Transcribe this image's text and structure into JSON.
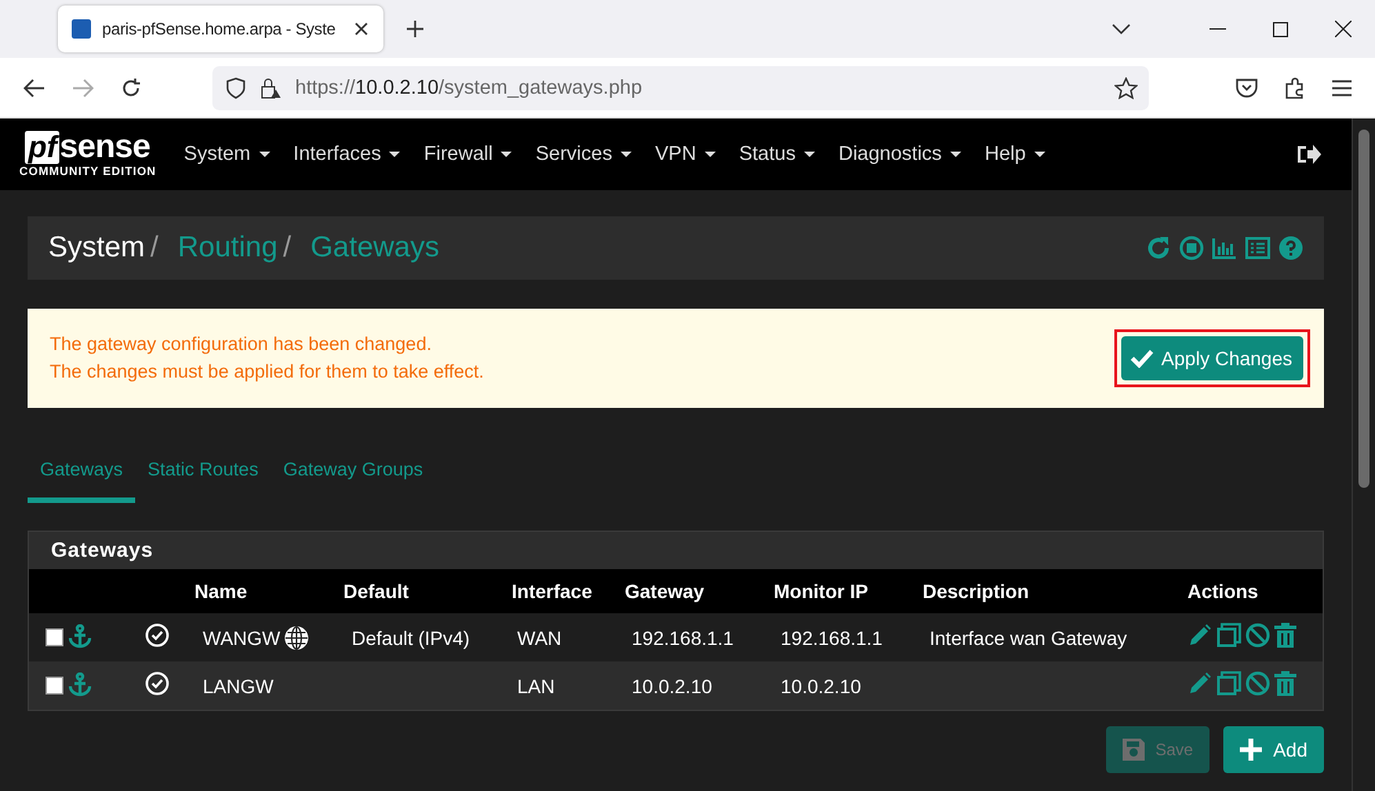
{
  "browser": {
    "tab_title": "paris-pfSense.home.arpa - Syste",
    "url_scheme": "https://",
    "url_host": "10.0.2.10",
    "url_path": "/system_gateways.php"
  },
  "logo": {
    "pf": "pf",
    "sense": "sense",
    "edition": "COMMUNITY EDITION"
  },
  "menu": [
    {
      "label": "System"
    },
    {
      "label": "Interfaces"
    },
    {
      "label": "Firewall"
    },
    {
      "label": "Services"
    },
    {
      "label": "VPN"
    },
    {
      "label": "Status"
    },
    {
      "label": "Diagnostics"
    },
    {
      "label": "Help"
    }
  ],
  "breadcrumb": [
    {
      "label": "System",
      "separator": "/",
      "link": false
    },
    {
      "label": "Routing",
      "separator": "/",
      "link": true
    },
    {
      "label": "Gateways",
      "link": true
    }
  ],
  "alert": {
    "lines": [
      "The gateway configuration has been changed.",
      "The changes must be applied for them to take effect."
    ],
    "button": "Apply Changes",
    "highlighted": true
  },
  "tabs": [
    {
      "label": "Gateways",
      "selected": true
    },
    {
      "label": "Static Routes",
      "selected": false
    },
    {
      "label": "Gateway Groups",
      "selected": false
    }
  ],
  "panel": {
    "title": "Gateways",
    "columns": [
      "Name",
      "Default",
      "Interface",
      "Gateway",
      "Monitor IP",
      "Description",
      "Actions"
    ],
    "rows": [
      {
        "checked": false,
        "name": "WANGW",
        "globe": true,
        "default": "Default (IPv4)",
        "interface": "WAN",
        "gateway": "192.168.1.1",
        "monitor_ip": "192.168.1.1",
        "description": "Interface wan Gateway"
      },
      {
        "checked": false,
        "name": "LANGW",
        "interface": "LAN",
        "gateway": "10.0.2.10",
        "monitor_ip": "10.0.2.10"
      }
    ]
  },
  "buttons": [
    {
      "label": "Save",
      "disabled": true
    },
    {
      "label": "Add",
      "disabled": false
    }
  ]
}
